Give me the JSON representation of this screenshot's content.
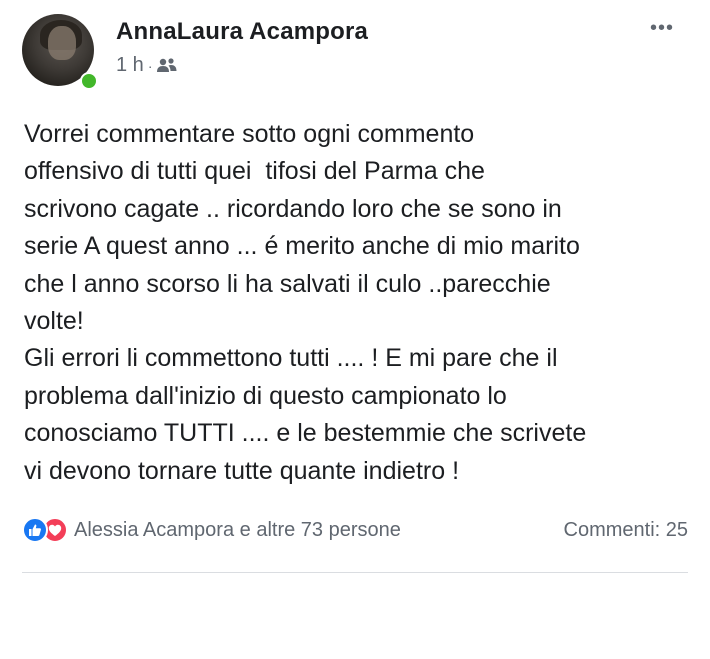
{
  "post": {
    "author": "AnnaLaura Acampora",
    "time": "1 h",
    "separator": "·",
    "audience_icon": "friends-icon",
    "more_icon": "more-options-icon",
    "more_label": "•••",
    "text": "Vorrei commentare sotto ogni commento\noffensivo di tutti quei  tifosi del Parma che\nscrivono cagate .. ricordando loro che se sono in\nserie A quest anno ... é merito anche di mio marito\nche l anno scorso li ha salvati il culo ..parecchie\nvolte!\nGli errori li commettono tutti .... ! E mi pare che il\nproblema dall'inizio di questo campionato lo\nconosciamo TUTTI .... e le bestemmie che scrivete\nvi devono tornare tutte quante indietro !"
  },
  "reactions": {
    "icons": [
      "like-icon",
      "love-icon"
    ],
    "summary": "Alessia Acampora e altre 73 persone"
  },
  "comments": {
    "label": "Commenti: 25"
  },
  "colors": {
    "like": "#1877f2",
    "love": "#f33e58",
    "online": "#42b72a",
    "secondary_text": "#606770"
  }
}
